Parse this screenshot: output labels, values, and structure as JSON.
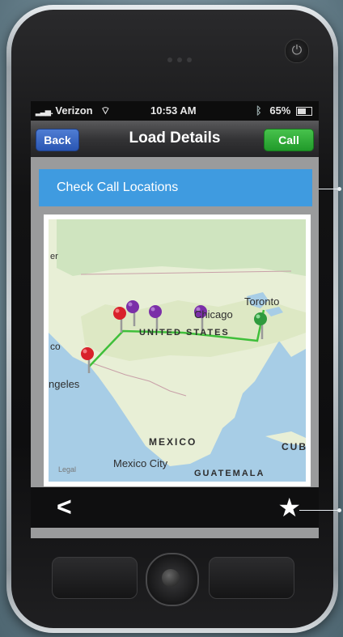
{
  "status_bar": {
    "carrier": "Verizon",
    "signal_icon": "signal-bars-icon",
    "wifi_icon": "wifi-icon",
    "time": "10:53 AM",
    "bluetooth_icon": "bluetooth-icon",
    "battery": "65%"
  },
  "nav": {
    "back_label": "Back",
    "title": "Load Details",
    "call_label": "Call"
  },
  "check_calls": {
    "label": "Check Call Locations"
  },
  "map": {
    "labels": {
      "chicago": "Chicago",
      "toronto": "Toronto",
      "united_states": "UNITED STATES",
      "los_angeles": "ngeles",
      "mexico": "MEXICO",
      "mexico_city": "Mexico City",
      "guatemala": "GUATEMALA",
      "cuba": "CUB",
      "legal": "Legal",
      "co": "co",
      "er": "er"
    },
    "pin_colors": {
      "red": "#d9212b",
      "purple": "#7b2fa8",
      "green": "#2f9a3d"
    },
    "route_color": "#3fbf3a"
  },
  "bottom_bar": {
    "back_glyph": "<",
    "star_glyph": "★"
  },
  "colors": {
    "accent_blue": "#3f9be0",
    "call_green": "#2eaa35",
    "back_blue": "#3566c4"
  }
}
